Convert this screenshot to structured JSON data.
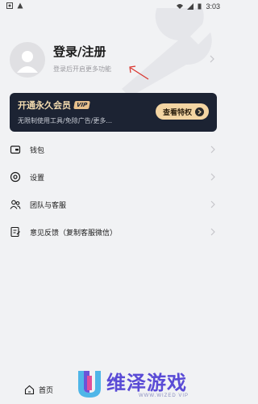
{
  "status_bar": {
    "time": "3:03"
  },
  "profile": {
    "title": "登录/注册",
    "subtitle": "登录后开启更多功能"
  },
  "vip": {
    "title": "开通永久会员",
    "badge": "VIP",
    "description": "无限制使用工具/免除广告/更多...",
    "button_label": "查看特权"
  },
  "menu": [
    {
      "label": "钱包",
      "icon": "wallet-icon"
    },
    {
      "label": "设置",
      "icon": "settings-icon"
    },
    {
      "label": "团队与客服",
      "icon": "team-icon"
    },
    {
      "label": "意见反馈（复制客服微信）",
      "icon": "feedback-icon"
    }
  ],
  "bottom_nav": {
    "home_label": "首页"
  },
  "watermark": {
    "title": "维泽游戏",
    "subtitle": "WWW.WIZED VIP"
  },
  "colors": {
    "vip_card_bg": "#1c2333",
    "vip_gold": "#f3d5a3",
    "watermark_purple": "#5a4bd6",
    "annotation_red": "#d9322b"
  }
}
